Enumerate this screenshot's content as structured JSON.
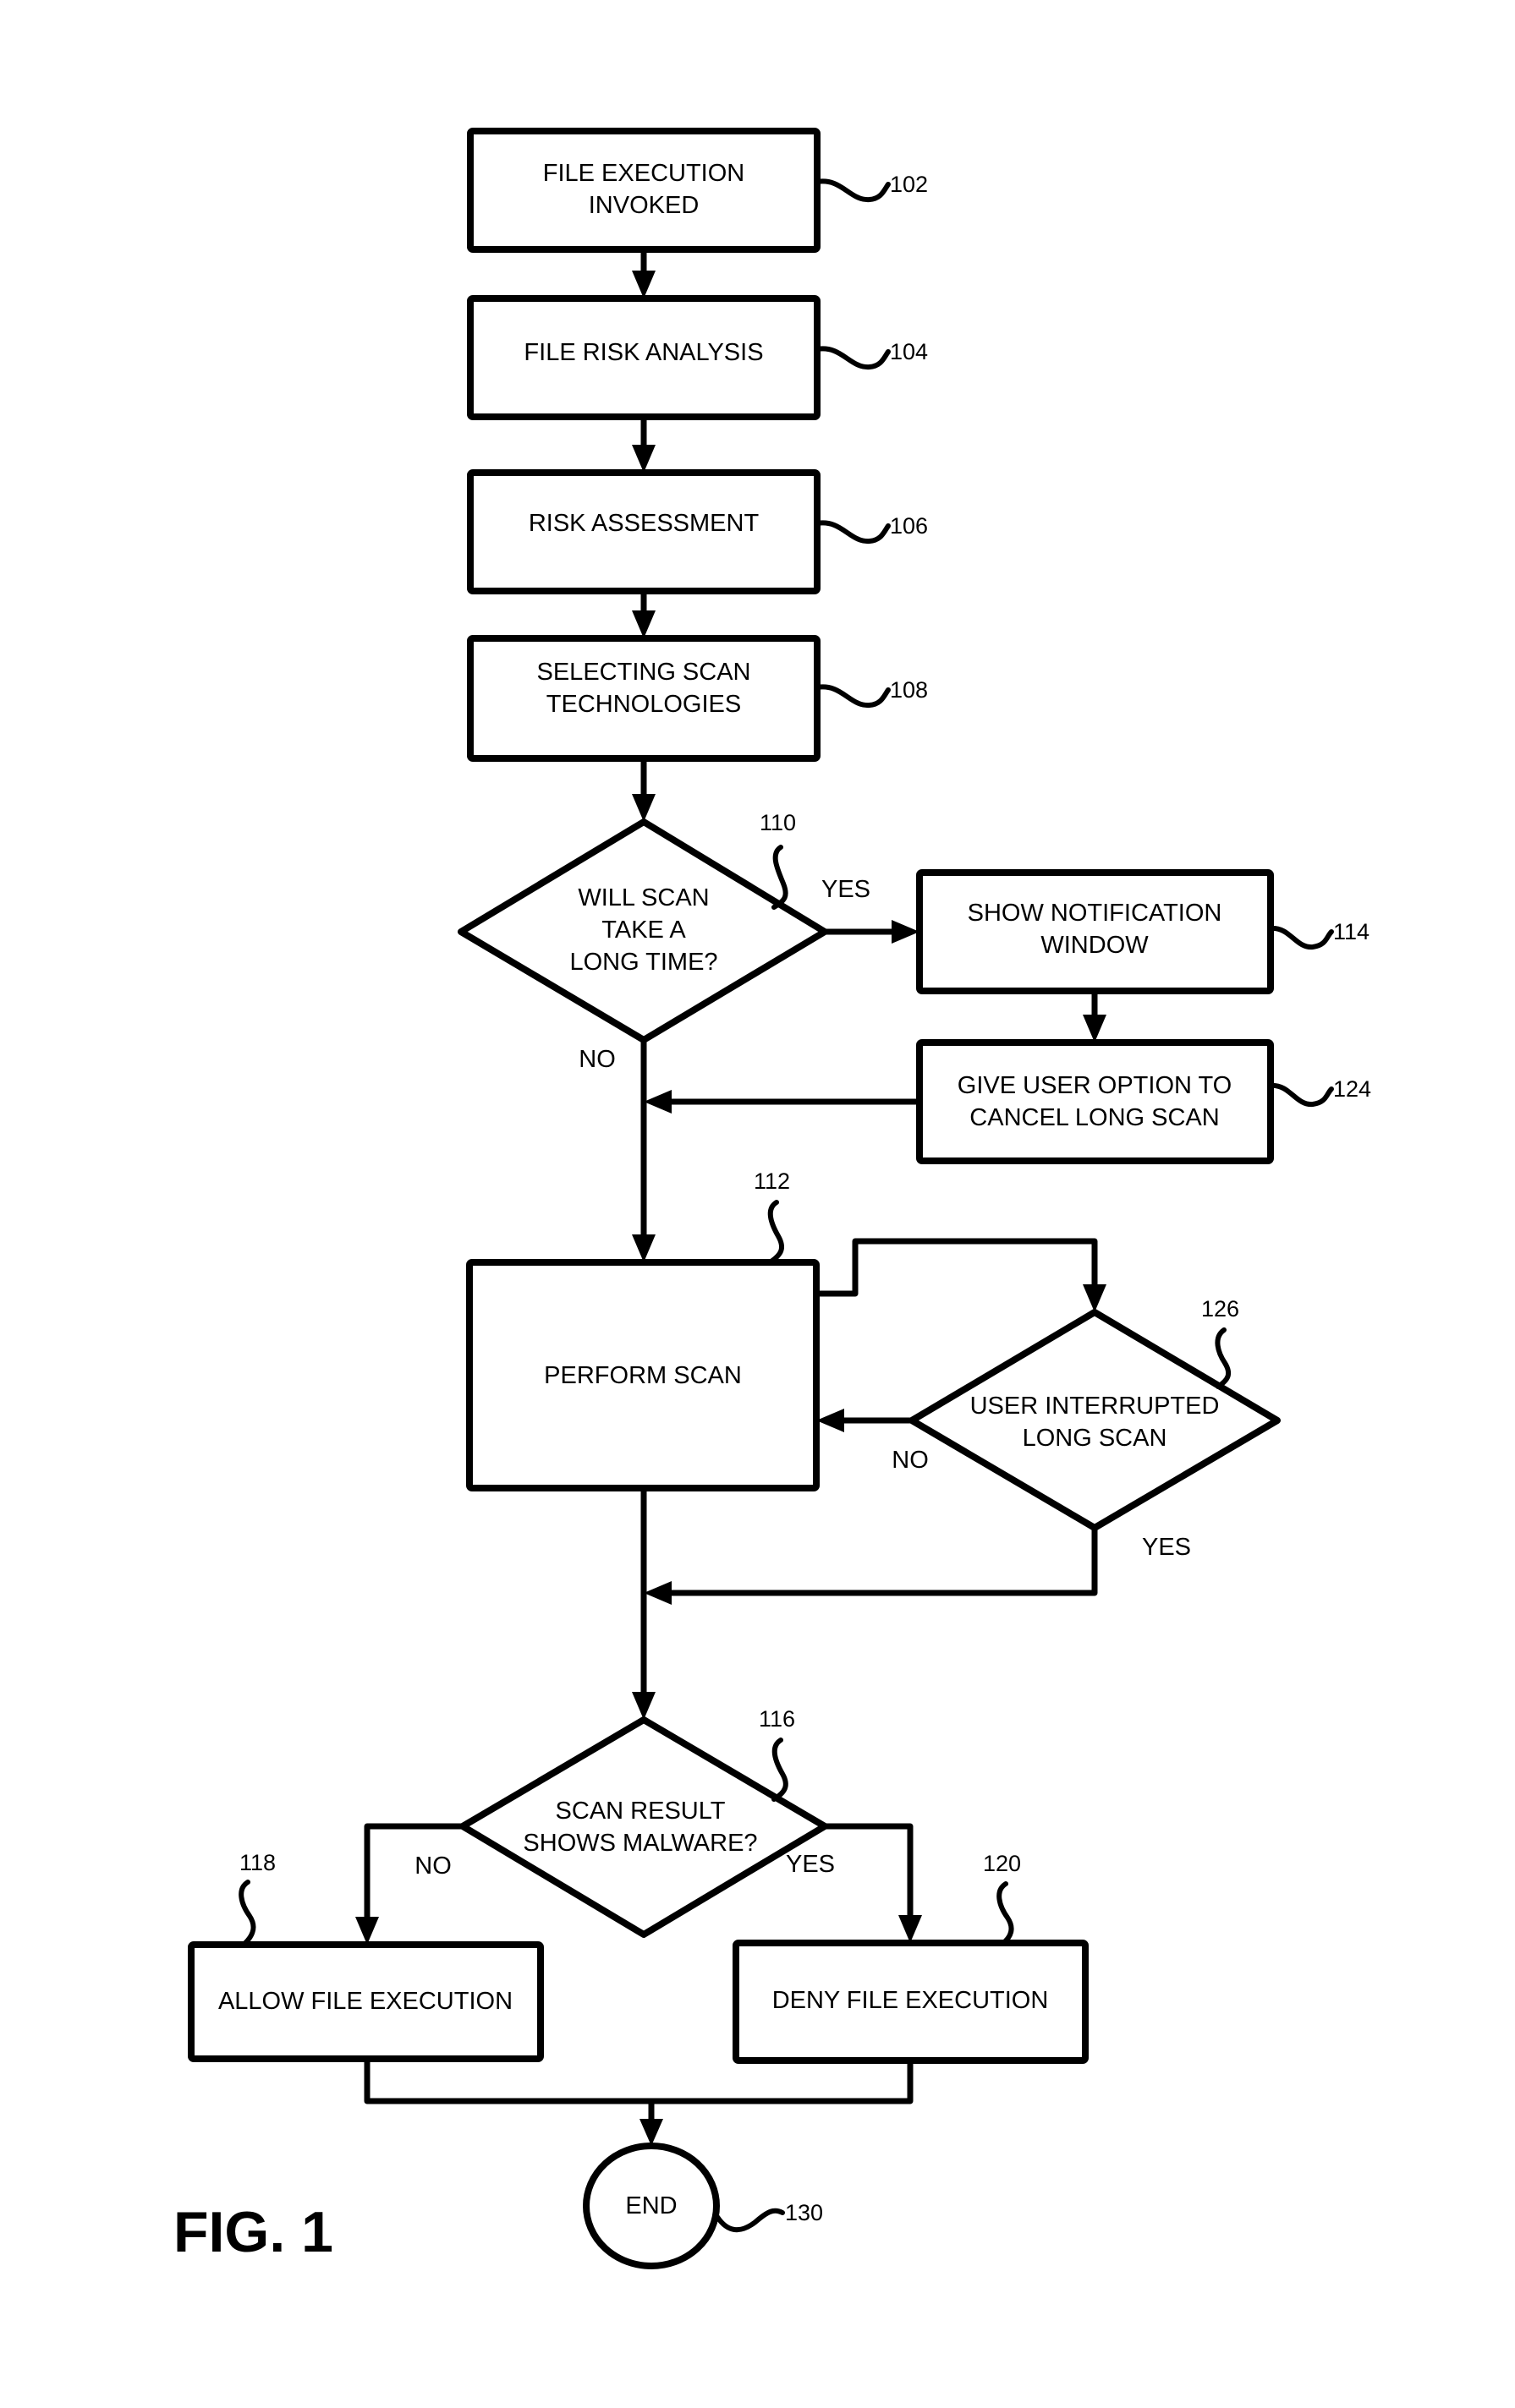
{
  "figure": {
    "label": "FIG. 1",
    "line_color": "#000000",
    "background": "#ffffff"
  },
  "nodes": {
    "n102": {
      "ref": "102",
      "shape": "rect",
      "lines": [
        "FILE EXECUTION",
        "INVOKED"
      ]
    },
    "n104": {
      "ref": "104",
      "shape": "rect",
      "lines": [
        "FILE RISK ANALYSIS"
      ]
    },
    "n106": {
      "ref": "106",
      "shape": "rect",
      "lines": [
        "RISK ASSESSMENT"
      ]
    },
    "n108": {
      "ref": "108",
      "shape": "rect",
      "lines": [
        "SELECTING SCAN",
        "TECHNOLOGIES"
      ]
    },
    "n110": {
      "ref": "110",
      "shape": "diamond",
      "lines": [
        "WILL SCAN",
        "TAKE A",
        "LONG TIME?"
      ]
    },
    "n114": {
      "ref": "114",
      "shape": "rect",
      "lines": [
        "SHOW NOTIFICATION",
        "WINDOW"
      ]
    },
    "n124": {
      "ref": "124",
      "shape": "rect",
      "lines": [
        "GIVE USER OPTION TO",
        "CANCEL LONG SCAN"
      ]
    },
    "n112": {
      "ref": "112",
      "shape": "rect",
      "lines": [
        "PERFORM SCAN"
      ]
    },
    "n126": {
      "ref": "126",
      "shape": "diamond",
      "lines": [
        "USER INTERRUPTED",
        "LONG SCAN"
      ]
    },
    "n116": {
      "ref": "116",
      "shape": "diamond",
      "lines": [
        "SCAN RESULT",
        "SHOWS MALWARE?"
      ]
    },
    "n118": {
      "ref": "118",
      "shape": "rect",
      "lines": [
        "ALLOW FILE EXECUTION"
      ]
    },
    "n120": {
      "ref": "120",
      "shape": "rect",
      "lines": [
        "DENY FILE EXECUTION"
      ]
    },
    "n130": {
      "ref": "130",
      "shape": "terminal",
      "lines": [
        "END"
      ]
    }
  },
  "edges": [
    {
      "from": "102",
      "to": "104",
      "label": ""
    },
    {
      "from": "104",
      "to": "106",
      "label": ""
    },
    {
      "from": "106",
      "to": "108",
      "label": ""
    },
    {
      "from": "108",
      "to": "110",
      "label": ""
    },
    {
      "from": "110",
      "to": "114",
      "label": "YES"
    },
    {
      "from": "110",
      "to": "112",
      "label": "NO"
    },
    {
      "from": "114",
      "to": "124",
      "label": ""
    },
    {
      "from": "124",
      "to": "112",
      "label": ""
    },
    {
      "from": "112",
      "to": "126",
      "label": ""
    },
    {
      "from": "126",
      "to": "112",
      "label": "NO"
    },
    {
      "from": "126",
      "to": "116",
      "label": "YES"
    },
    {
      "from": "112",
      "to": "116",
      "label": ""
    },
    {
      "from": "116",
      "to": "118",
      "label": "NO"
    },
    {
      "from": "116",
      "to": "120",
      "label": "YES"
    },
    {
      "from": "118",
      "to": "130",
      "label": ""
    },
    {
      "from": "120",
      "to": "130",
      "label": ""
    }
  ],
  "branch_labels": {
    "d110_yes": "YES",
    "d110_no": "NO",
    "d126_no": "NO",
    "d126_yes": "YES",
    "d116_no": "NO",
    "d116_yes": "YES"
  }
}
